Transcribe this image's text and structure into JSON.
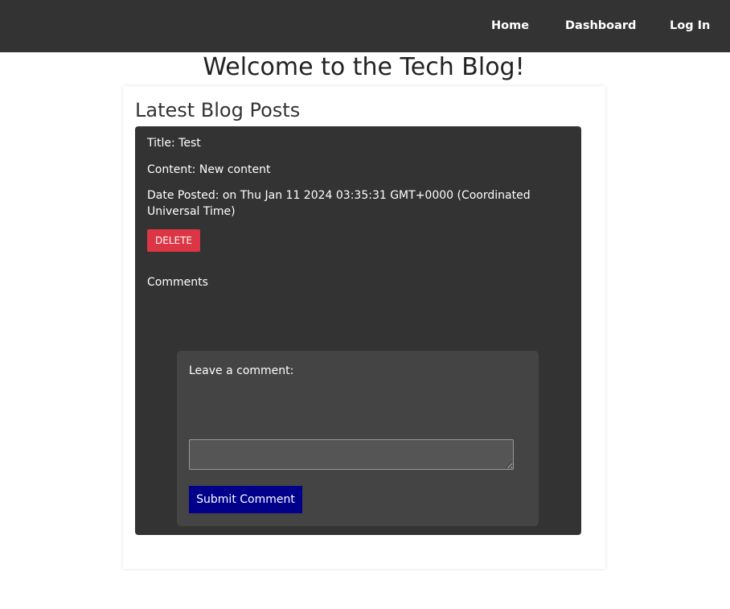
{
  "nav": {
    "home": "Home",
    "dashboard": "Dashboard",
    "login": "Log In"
  },
  "page": {
    "title": "Welcome to the Tech Blog!",
    "section_title": "Latest Blog Posts"
  },
  "post": {
    "title": "Title: Test",
    "content": "Content: New content",
    "date": "Date Posted: on Thu Jan 11 2024 03:35:31 GMT+0000 (Coordinated Universal Time)",
    "delete_label": "DELETE",
    "comments_heading": "Comments"
  },
  "comment_form": {
    "label": "Leave a comment:",
    "input_value": "",
    "submit_label": "Submit Comment"
  },
  "colors": {
    "navbar": "#333333",
    "card": "#333333",
    "form": "#444444",
    "delete": "#dc3545",
    "submit": "#00008b"
  }
}
